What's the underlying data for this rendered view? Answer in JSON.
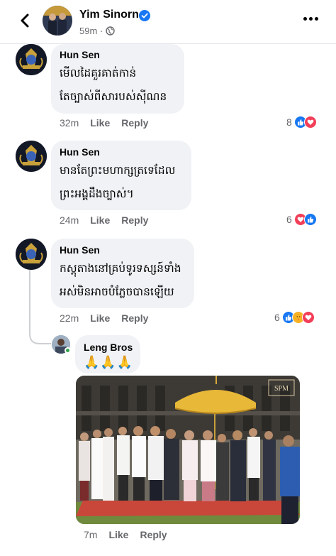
{
  "header": {
    "name": "Yim Sinorn",
    "meta": "59m ·",
    "icons": [
      "back-icon",
      "verified-icon",
      "globe-icon",
      "more-icon"
    ]
  },
  "comments": [
    {
      "author": "Hun Sen",
      "lines": [
        "មើលដៃគួរគាត់កាន់",
        "តែច្បាស់ពីសារបស់ស៊ីណន"
      ],
      "time": "32m",
      "like": "Like",
      "reply": "Reply",
      "reaction_count": "8",
      "reactions": [
        "like",
        "love"
      ]
    },
    {
      "author": "Hun Sen",
      "lines": [
        "មានតែព្រះមហាក្សត្រទេដែល",
        "ព្រះអង្គដឹងច្បាស់។"
      ],
      "time": "24m",
      "like": "Like",
      "reply": "Reply",
      "reaction_count": "6",
      "reactions": [
        "love",
        "like"
      ]
    },
    {
      "author": "Hun Sen",
      "lines": [
        "កស្តុតាងនៅគ្រប់ទូរទស្សន៍ទាំង",
        "អស់មិនអាចបំភ្លែចបានឡើយ"
      ],
      "time": "22m",
      "like": "Like",
      "reply": "Reply",
      "reaction_count": "6",
      "reactions": [
        "like",
        "care",
        "love"
      ]
    }
  ],
  "reply": {
    "author": "Leng Bros",
    "text": "🙏🙏🙏",
    "photo_watermark": "SPM",
    "time": "7m",
    "like": "Like",
    "reply": "Reply"
  },
  "colors": {
    "fb_blue": "#1877f2",
    "love_red": "#f33e58",
    "care_yellow": "#f7b125",
    "meta_gray": "#65676b",
    "bubble": "#f0f2f5"
  }
}
